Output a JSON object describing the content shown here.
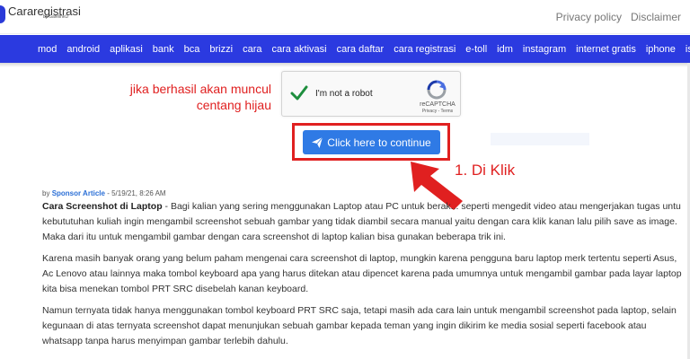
{
  "header": {
    "logo_text": "Cararegistrasi",
    "logo_sub": "by SafelinkU",
    "links": [
      "Privacy policy",
      "Disclaimer"
    ]
  },
  "nav": {
    "items": [
      "mod",
      "android",
      "aplikasi",
      "bank",
      "bca",
      "brizzi",
      "cara",
      "cara aktivasi",
      "cara daftar",
      "cara registrasi",
      "e-toll",
      "idm",
      "instagram",
      "internet gratis",
      "iphone",
      "isaku"
    ]
  },
  "annotation": {
    "note_line1": "jika berhasil akan muncul",
    "note_line2": "centang hijau",
    "click_label": "1. Di Klik"
  },
  "recaptcha": {
    "label": "I'm not a robot",
    "brand": "reCAPTCHA",
    "terms": "Privacy - Terms"
  },
  "button": {
    "label": "Click here to continue"
  },
  "article": {
    "byline_prefix": "by",
    "author": "Sponsor Article",
    "date": "- 5/19/21, 8:26 AM",
    "title": "Cara Screenshot di Laptop",
    "p1_rest": " - Bagi kalian yang sering menggunakan Laptop atau PC untuk berak... seperti mengedit video atau mengerjakan tugas untu kebututuhan kuliah ingin mengambil screenshot sebuah gambar yang tidak diambil secara manual yaitu dengan cara klik kanan lalu pilih save as image. Maka dari itu untuk mengambil gambar dengan cara screenshot di laptop kalian bisa gunakan beberapa trik ini.",
    "p2": "Karena masih banyak orang yang belum paham mengenai cara screenshot di laptop, mungkin karena pengguna baru laptop merk tertentu seperti Asus, Ac Lenovo atau lainnya maka tombol keyboard apa yang harus ditekan atau dipencet karena pada umumnya untuk mengambil gambar pada layar laptop kita bisa menekan tombol PRT SRC disebelah kanan keyboard.",
    "p3": "Namun ternyata tidak hanya menggunakan tombol keyboard PRT SRC saja, tetapi masih ada cara lain untuk mengambil screenshot pada laptop, selain kegunaan di atas ternyata screenshot dapat menunjukan sebuah gambar kepada teman yang ingin dikirim ke media sosial seperti facebook atau whatsapp tanpa harus menyimpan gambar terlebih dahulu."
  },
  "colors": {
    "nav_bg": "#2b3ae0",
    "button_bg": "#2f7ae5",
    "annotation_red": "#e02020",
    "check_green": "#1e8e3e"
  }
}
